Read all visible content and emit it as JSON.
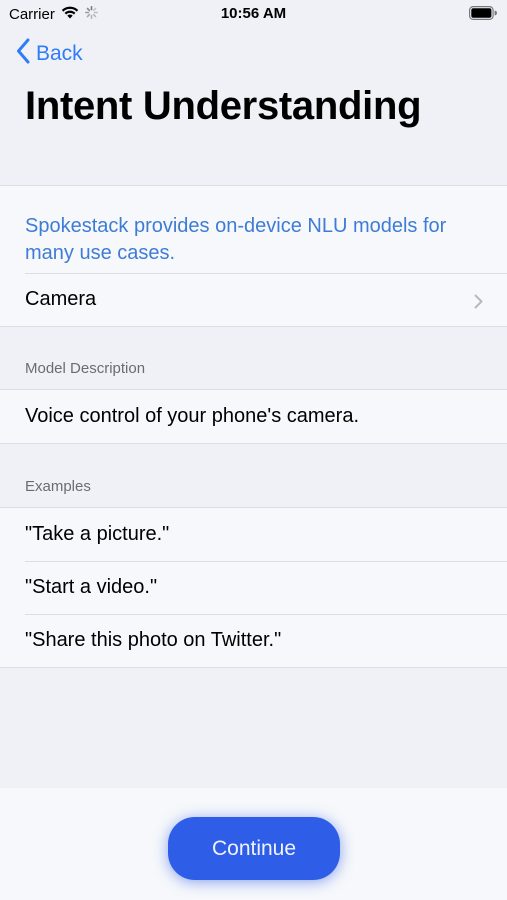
{
  "status_bar": {
    "carrier": "Carrier",
    "time": "10:56 AM",
    "icons": [
      "wifi-icon",
      "activity-spinner-icon",
      "battery-icon"
    ]
  },
  "nav": {
    "back_label": "Back"
  },
  "page": {
    "title": "Intent Understanding"
  },
  "intro": {
    "text": "Spokestack provides on-device NLU models for many use cases."
  },
  "model_picker": {
    "selected": "Camera"
  },
  "model_description": {
    "header": "Model Description",
    "text": "Voice control of your phone's camera."
  },
  "examples": {
    "header": "Examples",
    "items": [
      "\"Take a picture.\"",
      "\"Start a video.\"",
      "\"Share this photo on Twitter.\""
    ]
  },
  "footer": {
    "continue_label": "Continue"
  },
  "colors": {
    "accent": "#2f7df6",
    "intro_text": "#3e7cd5",
    "button": "#2e5de7",
    "background": "#eff1f6",
    "cell": "#f6f8fb"
  }
}
